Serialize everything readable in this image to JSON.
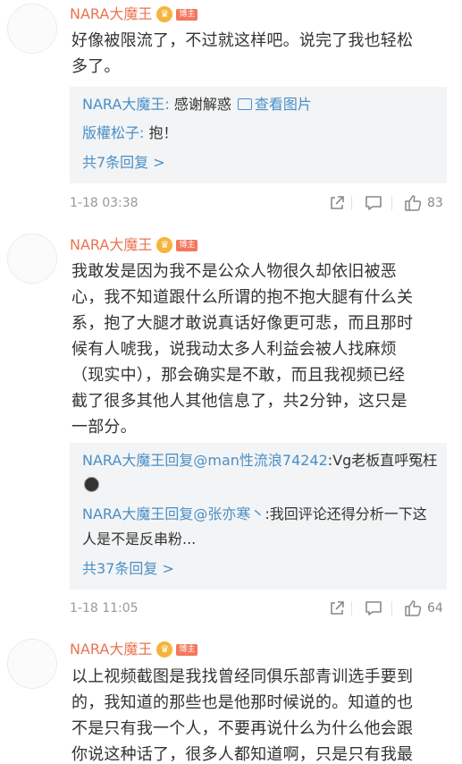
{
  "comments": [
    {
      "username": "NARA大魔王",
      "badge": "博主",
      "lines": [
        "好像被限流了，不过就这样吧。说完了我也轻松",
        "多了。"
      ],
      "replies": [
        {
          "author": "NARA大魔王:",
          "text": " 感谢解惑 ",
          "link": "查看图片"
        },
        {
          "author": "版權松子:",
          "text": " 抱！"
        }
      ],
      "more": "共7条回复 >",
      "time": "1-18 03:38",
      "likes": "83"
    },
    {
      "username": "NARA大魔王",
      "badge": "博主",
      "lines": [
        "我敢发是因为我不是公众人物很久却依旧被恶",
        "心，我不知道跟什么所谓的抱不抱大腿有什么关",
        "系，抱了大腿才敢说真话好像更可悲，而且那时",
        "候有人唬我，说我动太多人利益会被人找麻烦",
        "（现实中），那会确实是不敢，而且我视频已经",
        "截了很多其他人其他信息了，共2分钟，这只是",
        "一部分。"
      ],
      "replies": [
        {
          "author": "NARA大魔王",
          "text": "回复",
          "mention": "@man性流浪74242",
          "rest": ":Vg老板直呼冤枉"
        },
        {
          "author": "NARA大魔王",
          "text": "回复",
          "mention": "@张亦寒丶",
          "rest": ":我回评论还得分析一下这人是不是反串粉..."
        }
      ],
      "more": "共37条回复 >",
      "time": "1-18 11:05",
      "likes": "64"
    },
    {
      "username": "NARA大魔王",
      "badge": "博主",
      "lines": [
        "以上视频截图是我找曾经同俱乐部青训选手要到",
        "的，我知道的那些也是他那时候说的。知道的也",
        "不是只有我一个人，不要再说什么为什么他会跟",
        "你说这种话了，很多人都知道啊，只是只有我最"
      ]
    }
  ],
  "colors": {
    "username": "#eb7350",
    "link": "#4a8fc6",
    "meta": "#999999",
    "reply_bg": "#f3f4f5"
  }
}
